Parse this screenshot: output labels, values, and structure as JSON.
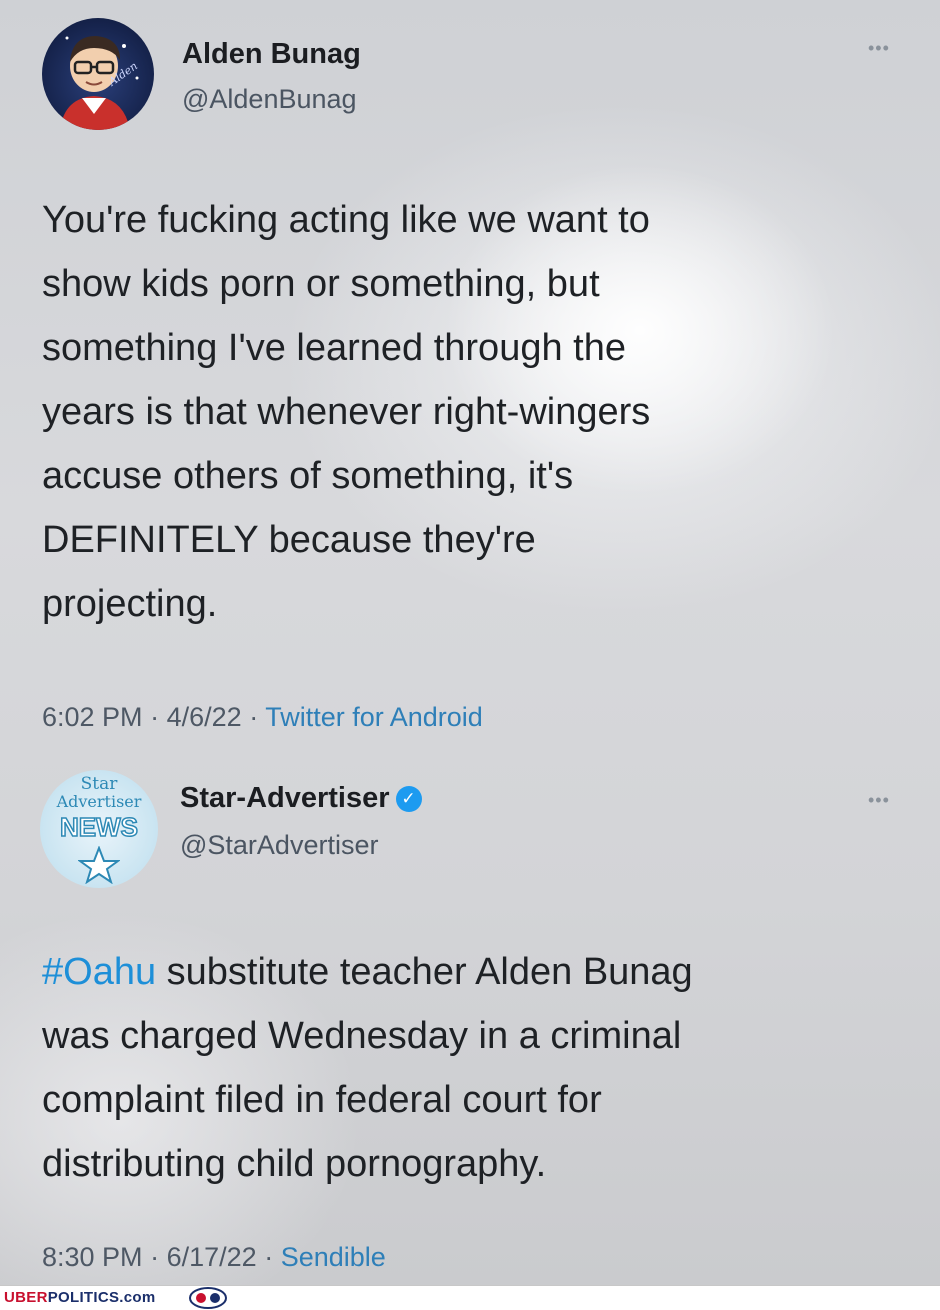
{
  "tweet1": {
    "display_name": "Alden Bunag",
    "handle": "@AldenBunag",
    "more_label": "•••",
    "text": "You're fucking acting like we want to\nshow kids porn or something, but\nsomething I've learned through the\nyears is that whenever right-wingers\naccuse others of something, it's\nDEFINITELY because they're\nprojecting.",
    "time": "6:02 PM",
    "date": "4/6/22",
    "separator": "·",
    "source": "Twitter for Android"
  },
  "tweet2": {
    "display_name": "Star-Advertiser",
    "handle": "@StarAdvertiser",
    "verified_mark": "✓",
    "more_label": "•••",
    "avatar_lines": [
      "Star",
      "Advertiser",
      "NEWS"
    ],
    "hashtag": "#Oahu",
    "text": " substitute teacher Alden Bunag\nwas charged Wednesday in a criminal\ncomplaint filed in federal court for\ndistributing child pornography.",
    "time": "8:30 PM",
    "date": "6/17/22",
    "separator": "·",
    "source": "Sendible"
  },
  "watermark": {
    "brand_red": "UBER",
    "brand_blue": "POLITICS.com"
  },
  "colors": {
    "link": "#1d8fd8",
    "verified": "#1d9bf0",
    "watermark_red": "#c8102e",
    "watermark_blue": "#1b2f6b"
  }
}
